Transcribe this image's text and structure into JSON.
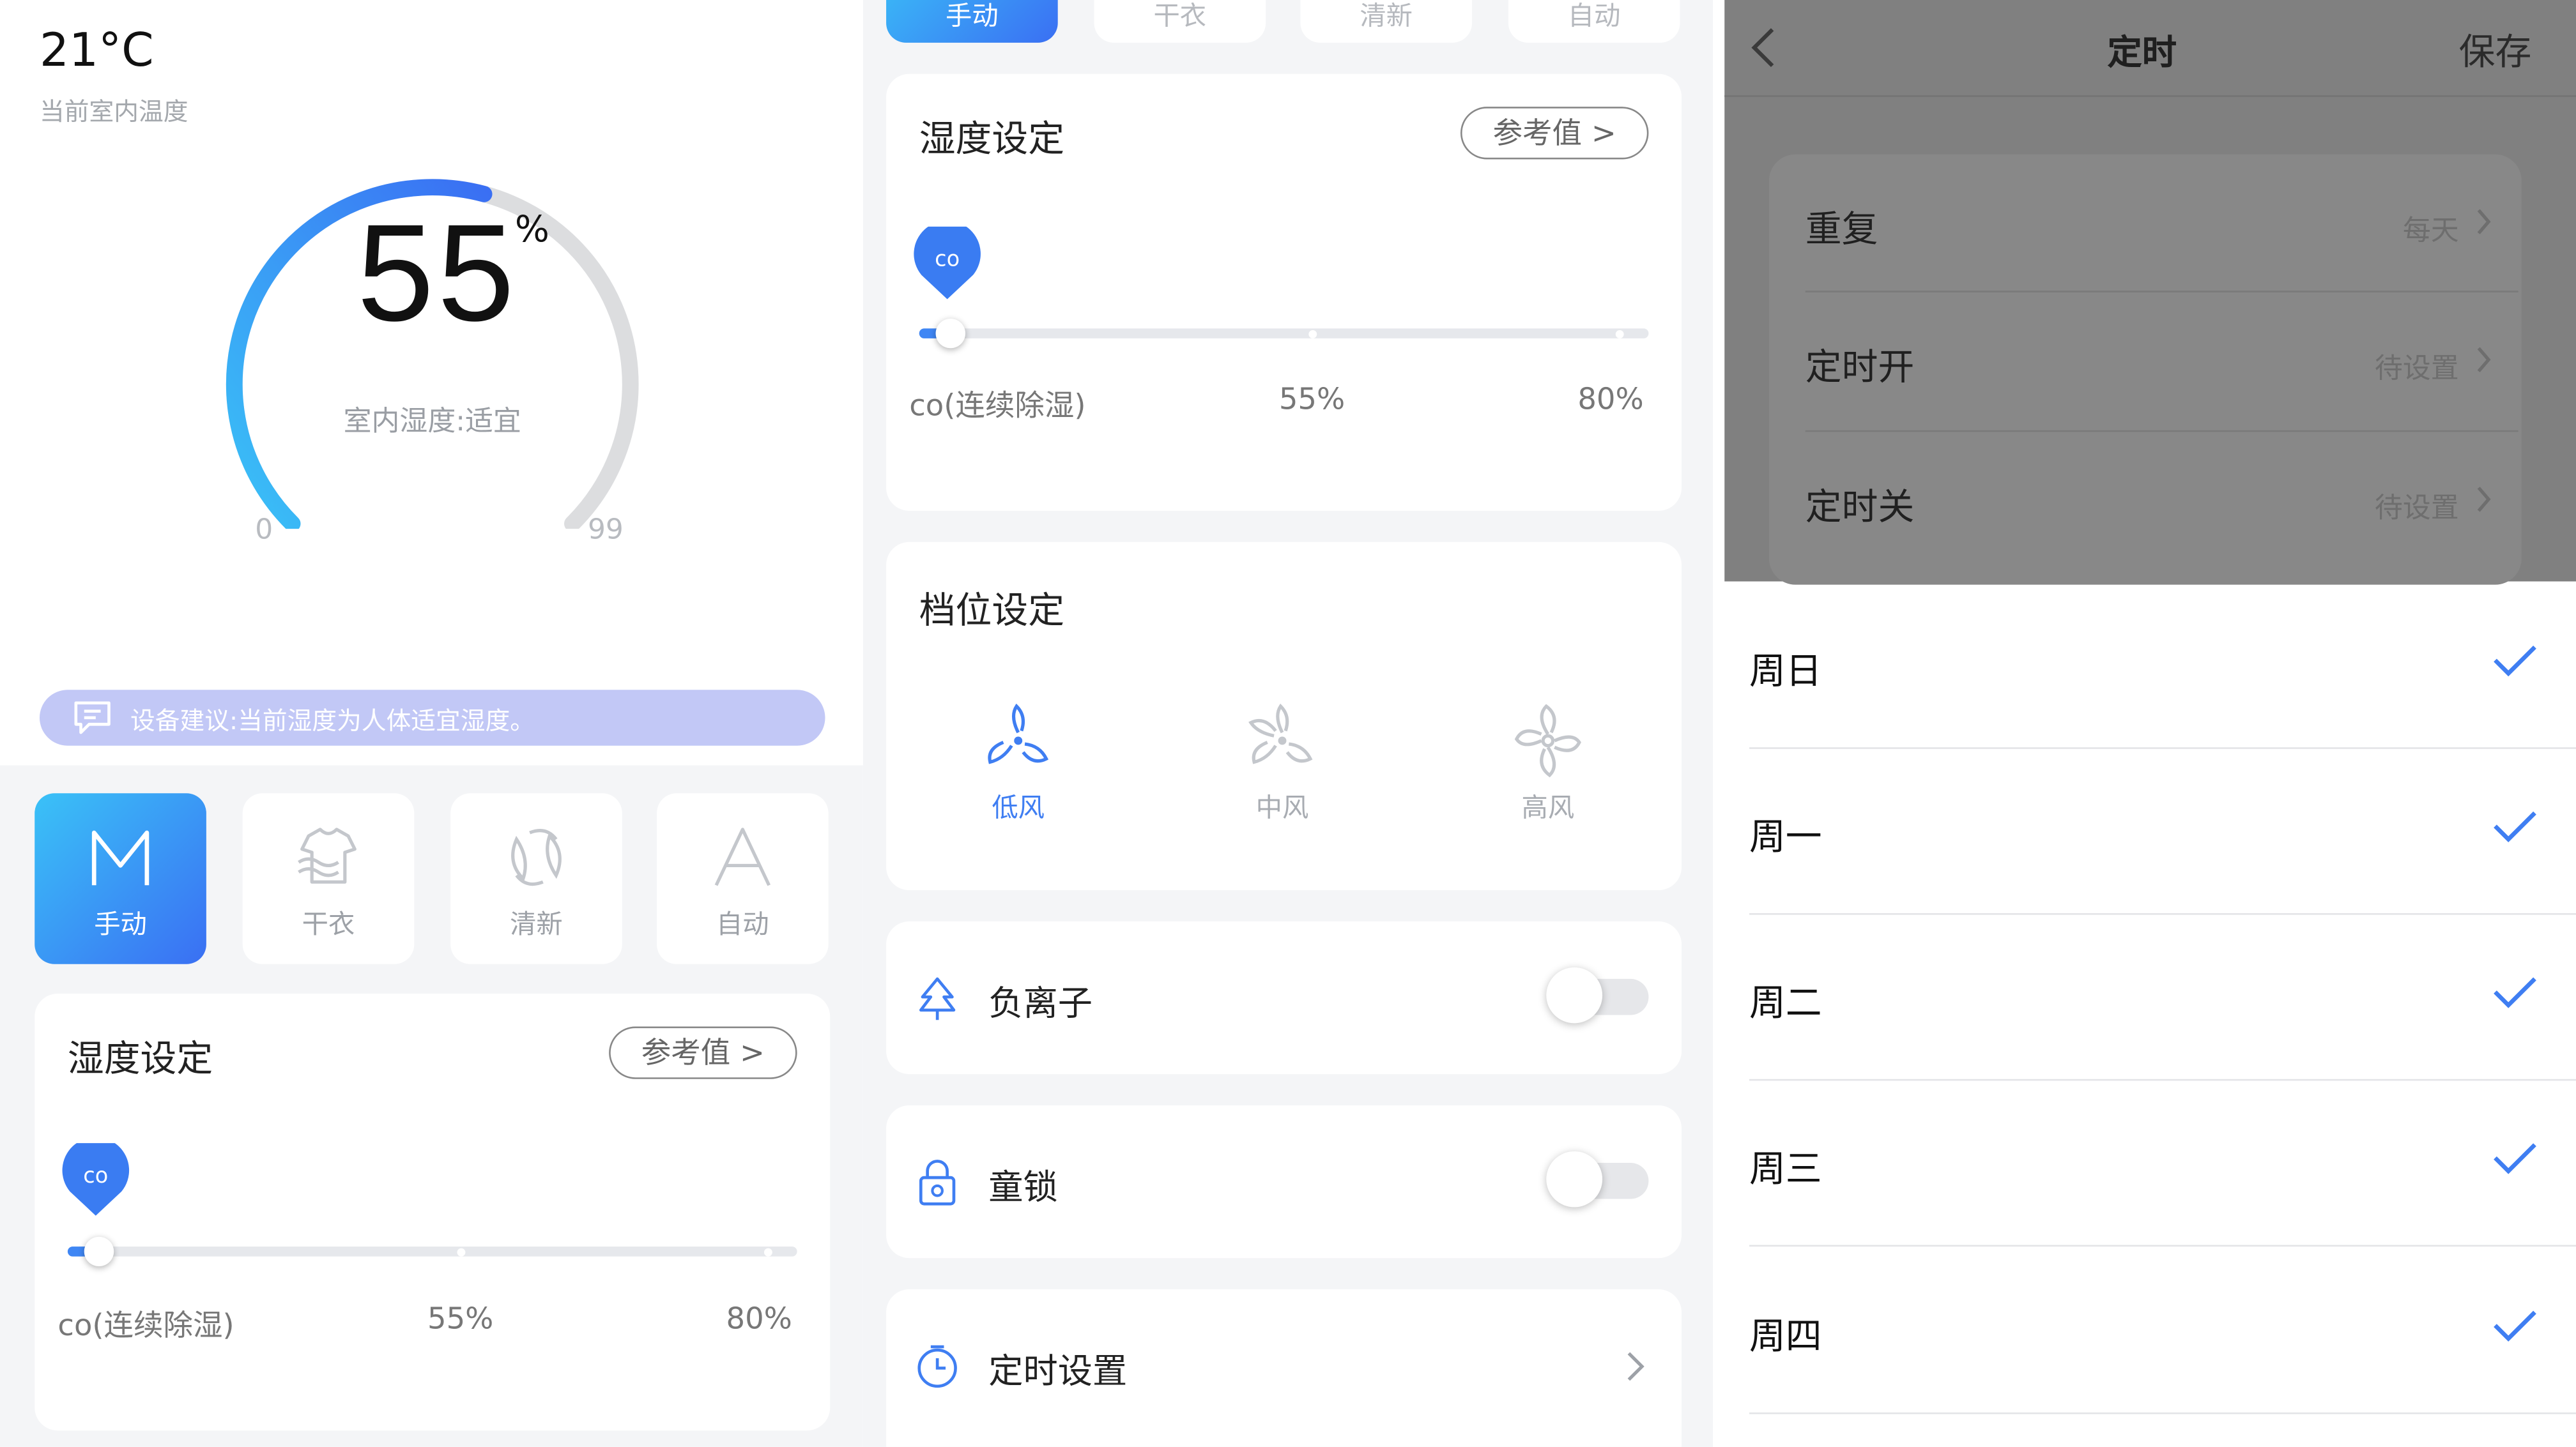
{
  "panel_main": {
    "temperature": "21°C",
    "temperature_label": "当前室内温度",
    "gauge": {
      "value": "55",
      "unit": "%",
      "status": "室内湿度:适宜",
      "min": "0",
      "max": "99",
      "level": 0.556
    },
    "advice": "设备建议:当前湿度为人体适宜湿度。",
    "modes": [
      {
        "label": "手动",
        "icon": "manual-m-icon",
        "active": true
      },
      {
        "label": "干衣",
        "icon": "shirt-icon",
        "active": false
      },
      {
        "label": "清新",
        "icon": "leaf-refresh-icon",
        "active": false
      },
      {
        "label": "自动",
        "icon": "auto-a-icon",
        "active": false
      }
    ],
    "humidity": {
      "title": "湿度设定",
      "ref_button": "参考值 >",
      "pin": "co",
      "labels": [
        "co(连续除湿)",
        "55%",
        "80%"
      ],
      "position": 0.04
    }
  },
  "panel_settings": {
    "tabs": [
      {
        "label": "手动",
        "active": true
      },
      {
        "label": "干衣",
        "active": false
      },
      {
        "label": "清新",
        "active": false
      },
      {
        "label": "自动",
        "active": false
      }
    ],
    "humidity": {
      "title": "湿度设定",
      "ref_button": "参考值 >",
      "pin": "co",
      "labels": [
        "co(连续除湿)",
        "55%",
        "80%"
      ],
      "position": 0.04
    },
    "fan": {
      "title": "档位设定",
      "options": [
        {
          "label": "低风",
          "active": true
        },
        {
          "label": "中风",
          "active": false
        },
        {
          "label": "高风",
          "active": false
        }
      ]
    },
    "anion": {
      "label": "负离子",
      "icon": "tree-icon",
      "on": false
    },
    "child_lock": {
      "label": "童锁",
      "icon": "lock-icon",
      "on": false
    },
    "timer": {
      "label": "定时设置",
      "icon": "clock-icon"
    }
  },
  "panel_timer": {
    "nav": {
      "title": "定时",
      "save": "保存"
    },
    "rows": [
      {
        "label": "重复",
        "value": "每天"
      },
      {
        "label": "定时开",
        "value": "待设置"
      },
      {
        "label": "定时关",
        "value": "待设置"
      }
    ],
    "days": [
      {
        "label": "周日",
        "checked": true
      },
      {
        "label": "周一",
        "checked": true
      },
      {
        "label": "周二",
        "checked": true
      },
      {
        "label": "周三",
        "checked": true
      },
      {
        "label": "周四",
        "checked": true
      }
    ],
    "colors": {
      "check": "#3f7ef2",
      "overlay": "#808080"
    }
  },
  "colors": {
    "accent_start": "#3ac2f7",
    "accent_end": "#3a6ff3",
    "advice_bg": "#c2c8f6",
    "page_bg": "#f4f5f7"
  }
}
